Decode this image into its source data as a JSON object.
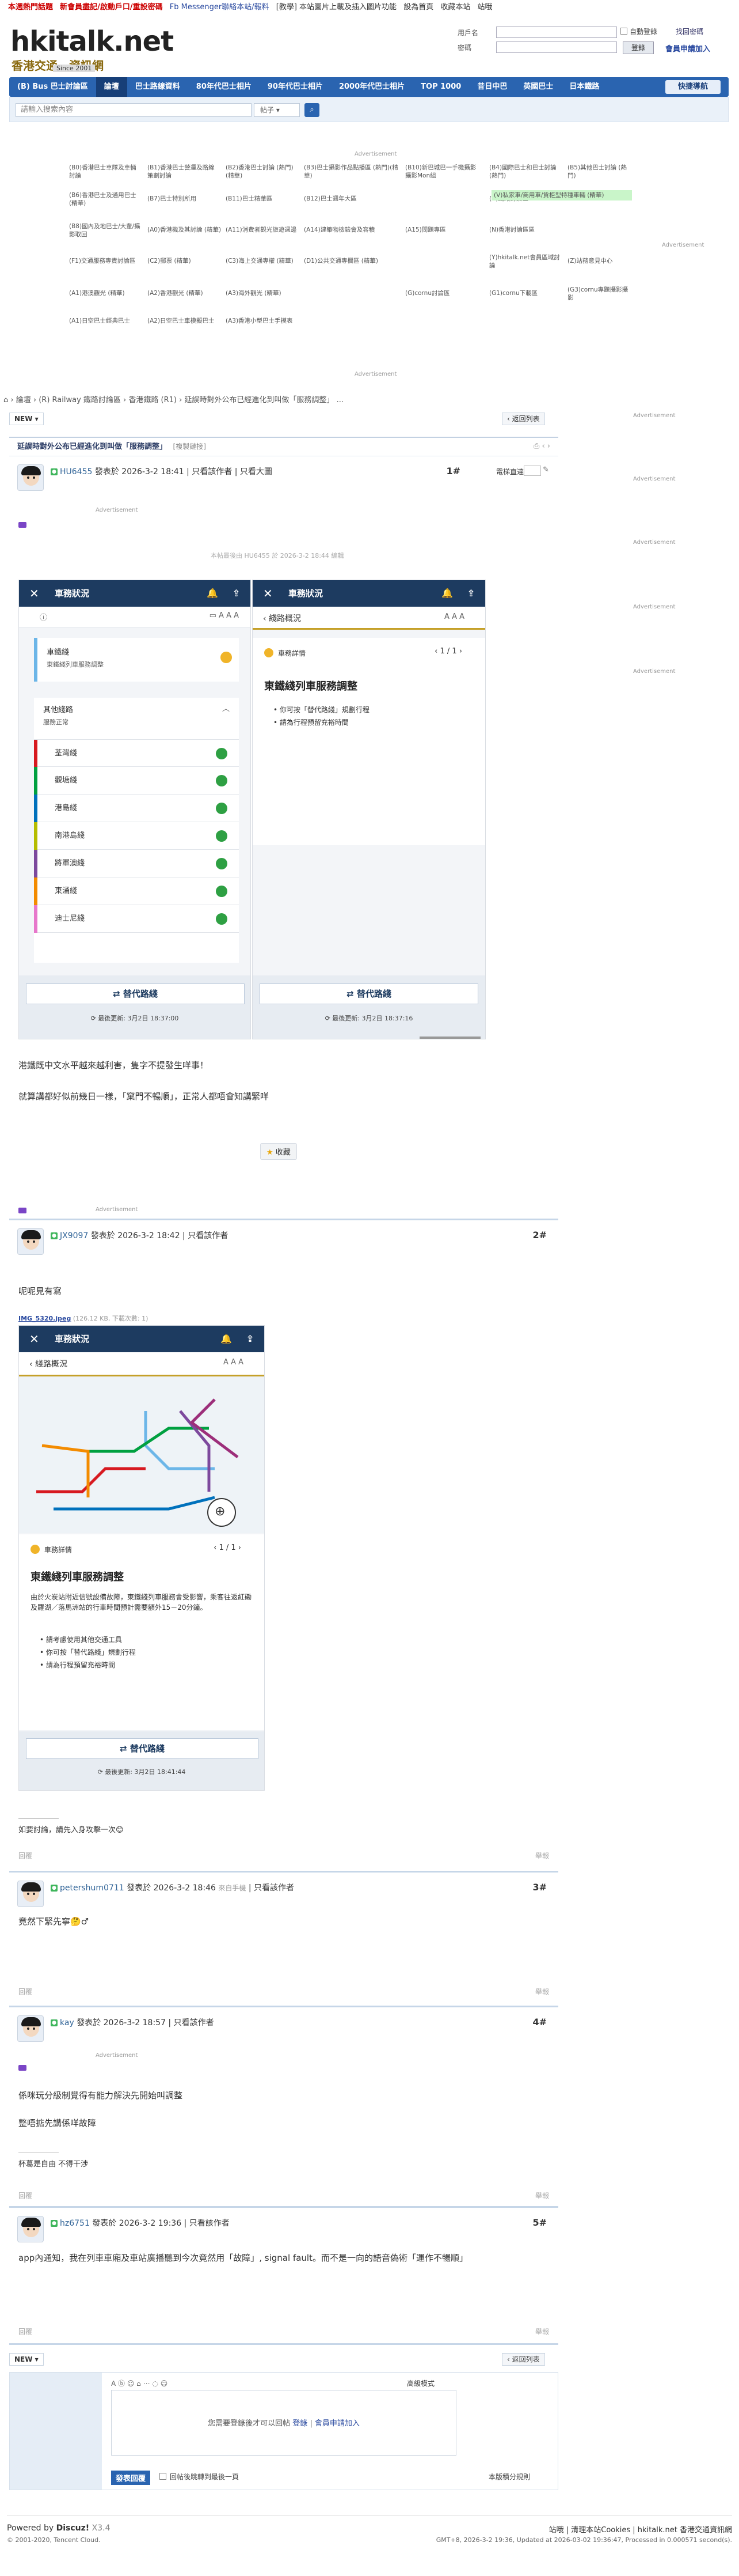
{
  "topbar": {
    "items": [
      {
        "label": "本週熱門話題",
        "color": "#cc0000"
      },
      {
        "label": "新會員盡記/啟動戶口/重設密碼",
        "color": "#cc0000"
      },
      {
        "label": "Fb Messenger聯絡本站/報料",
        "color": "#2a4aa0"
      },
      {
        "label": "[教學] 本站圖片上載及插入圖片功能",
        "color": "#333333"
      },
      {
        "label": "設為首頁",
        "color": "#333333"
      },
      {
        "label": "收藏本站",
        "color": "#333333"
      },
      {
        "label": "站哦",
        "color": "#333333"
      }
    ]
  },
  "header": {
    "logo": "hkitalk.net",
    "logo_sub": "香港交通．資訊網",
    "since": "Since 2001",
    "login": {
      "user_label": "用戶名",
      "password_label": "密碼",
      "auto_login": "自動登錄",
      "find_password": "找回密碼",
      "login_button": "登錄",
      "register": "會員申請加入"
    }
  },
  "nav": {
    "items": [
      "(B) Bus 巴士討論區",
      "論壇",
      "巴士路線資料",
      "80年代巴士相片",
      "90年代巴士相片",
      "2000年代巴士相片",
      "TOP 1000",
      "昔日中巴",
      "英國巴士",
      "日本鐵路"
    ],
    "active_index": 1,
    "quick": "快捷導航"
  },
  "search": {
    "placeholder": "請輸入搜索內容",
    "select": "帖子",
    "button": "搜索"
  },
  "ad_label": "Advertisement",
  "forum_links": [
    "(B0)香港巴士車隊及車輛討論",
    "(B1)香港巴士營運及路線策劃討論",
    "(B2)香港巴士討論 (熱門)(精華)",
    "(B3)巴士攝影作品點播區 (熱門)(精華)",
    "(B10)新巴城巴一手機攝影攝影Mon組",
    "(B4)國際巴士和巴士討論(熱門)",
    "(B5)其他巴士討論 (熱門)",
    "(B6)香港巴士及通用巴士(精華)",
    "(B7)巴士特別所用",
    "(B11)巴士精華區",
    "(B12)巴士週年大區",
    "(R)鐵路討論區",
    "(V)私家車/商用車/貨柜型特種車輛 (精華)",
    "(B8)國內及地巴士/大輩/攝影取回",
    "(A0)香港機及其討論 (精華)",
    "(A11)消費者觀光旅遊週邊",
    "(A14)建築物檢驗會及容積",
    "(A15)問題專區",
    "(N)香港討論區區",
    "(F1)交通服務專責討論區",
    "(C2)郵票 (精華)",
    "(C3)海上交通專權 (精華)",
    "(D1)公共交通專欄區 (精華)",
    "(Y)hkitalk.net會員區域討論",
    "(Z)站務意見中心",
    "(A1)港澳觀光 (精華)",
    "(A2)香港觀光 (精華)",
    "(A3)海外觀光 (精華)",
    "(G)cornu討論區",
    "(G1)cornu下載區",
    "(G3)cornu專題攝影攝影",
    "(A1)日空巴士經典巴士",
    "(A2)日空巴士車模擬巴士",
    "(A3)香港小型巴士手模表"
  ],
  "breadcrumb": {
    "items": [
      "論壇",
      "(R) Railway 鐵路討論區",
      "香港鐵路 (R1)",
      "延誤時對外公布已經進化到叫做「服務調整」"
    ],
    "home_icon": "home-icon"
  },
  "buttons": {
    "new": "NEW",
    "back": "返回列表"
  },
  "thread": {
    "title": "延誤時對外公布已經進化到叫做「服務調整」",
    "copy_link": "[複製鏈接]"
  },
  "post1": {
    "user": "HU6455",
    "time": "發表於 2026-3-2 18:41",
    "author_only": "只看該作者",
    "large": "只看大圖",
    "floor": "1#",
    "jump_label": "電梯直達",
    "last_edit": "本帖最後由 HU6455 於 2026-3-2 18:44 編輯",
    "phone_a": {
      "title": "車務狀況",
      "section": "車鐵綫",
      "section_sub": "東鐵綫列車服務調整",
      "other_title": "其他綫路",
      "other_sub": "服務正常",
      "lines": [
        {
          "name": "荃灣綫",
          "color": "#d71920"
        },
        {
          "name": "觀塘綫",
          "color": "#00a040"
        },
        {
          "name": "港島綫",
          "color": "#0071bc"
        },
        {
          "name": "南港島綫",
          "color": "#b5bd00"
        },
        {
          "name": "將軍澳綫",
          "color": "#7d499d"
        },
        {
          "name": "東涌綫",
          "color": "#f38b00"
        },
        {
          "name": "迪士尼綫",
          "color": "#e777cb"
        }
      ],
      "alt_button": "替代路綫",
      "updated": "最後更新: 3月2日 18:37:00"
    },
    "phone_b": {
      "title": "車務狀況",
      "sub_title": "綫路概況",
      "detail_label": "車務詳情",
      "pager": "1 / 1",
      "card_title": "東鐵綫列車服務調整",
      "bullets": [
        "你可按「替代路綫」規劃行程",
        "請為行程預留充裕時間"
      ],
      "alt_button": "替代路綫",
      "updated": "最後更新: 3月2日 18:37:16"
    },
    "text": [
      "港鐵既中文水平越來越利害，隻字不提發生咩事！",
      "就算講都好似前幾日一樣，「窠門不暢順」，正常人都唔會知講緊咩"
    ],
    "favorite": "收藏",
    "report": "舉報",
    "reply": "回覆"
  },
  "post2": {
    "user": "JX9097",
    "time": "發表於 2026-3-2 18:42",
    "author_only": "只看該作者",
    "floor": "2#",
    "text": "呢呢見有寫",
    "attachment": "IMG_5320.jpeg",
    "attachment_meta": "(126.12 KB, 下載次數: 1)",
    "phone": {
      "title": "車務狀況",
      "sub_title": "綫路概況",
      "detail_label": "車務詳情",
      "pager": "1 / 1",
      "card_title": "東鐵綫列車服務調整",
      "desc": "由於火炭站附近信號設備故障，東鐵綫列車服務會受影響，乘客往返紅磡及羅湖／落馬洲站的行車時間預計需要額外15－20分鐘。",
      "bullets": [
        "請考慮使用其他交通工具",
        "你可按「替代路綫」規劃行程",
        "請為行程預留充裕時間"
      ],
      "alt_button": "替代路綫",
      "updated": "最後更新: 3月2日 18:41:44"
    },
    "signature": "如要討論，請先入身攻擊一次😊",
    "reply": "回覆",
    "report": "舉報"
  },
  "post3": {
    "user": "petershum0711",
    "time": "發表於 2026-3-2 18:46",
    "device": "來自手機",
    "author_only": "只看該作者",
    "floor": "3#",
    "text": "竟然下緊先寧🤔♂",
    "reply": "回覆",
    "report": "舉報"
  },
  "post4": {
    "user": "kay",
    "time": "發表於 2026-3-2 18:57",
    "author_only": "只看該作者",
    "floor": "4#",
    "text": [
      "係咪玩分級制覺得有能力解決先開始叫調整",
      "整唔掂先講係咩故障"
    ],
    "signature": "杯葛是自由 不得干涉",
    "reply": "回覆",
    "report": "舉報"
  },
  "post5": {
    "user": "hz6751",
    "time": "發表於 2026-3-2 19:36",
    "author_only": "只看該作者",
    "floor": "5#",
    "text": "app內通知，我在列車車廂及車站廣播聽到今次竟然用「故障」, signal fault。而不是一向的語音偽術「運作不暢順」",
    "reply": "回覆",
    "report": "舉報"
  },
  "reply_box": {
    "advanced": "高級模式",
    "notice": "您需要登錄後才可以回帖",
    "login": "登錄",
    "separator": "|",
    "register": "會員申請加入",
    "submit": "發表回覆",
    "checkbox": "回帖後跳轉到最後一頁",
    "points": "本版積分規則"
  },
  "footer": {
    "powered": "Powered by",
    "discuz": "Discuz!",
    "version": "X3.4",
    "copyright": "© 2001-2020, Tencent Cloud.",
    "links": "站哦 | 清理本站Cookies | hkitalk.net 香港交通資訊網",
    "time": "GMT+8, 2026-3-2 19:36, Updated at 2026-03-02 19:36:47, Processed in 0.000571 second(s)."
  }
}
